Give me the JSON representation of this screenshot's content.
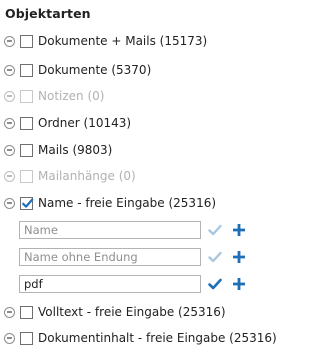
{
  "panel": {
    "title": "Objektarten",
    "items": [
      {
        "label": "Dokumente + Mails (15173)",
        "enabled": true,
        "checked": false
      },
      {
        "label": "Dokumente (5370)",
        "enabled": true,
        "checked": false
      },
      {
        "label": "Notizen (0)",
        "enabled": false,
        "checked": false
      },
      {
        "label": "Ordner (10143)",
        "enabled": true,
        "checked": false
      },
      {
        "label": "Mails (9803)",
        "enabled": true,
        "checked": false
      },
      {
        "label": "Mailanhänge (0)",
        "enabled": false,
        "checked": false
      },
      {
        "label": "Name - freie Eingabe (25316)",
        "enabled": true,
        "checked": true
      },
      {
        "label": "Volltext - freie Eingabe (25316)",
        "enabled": true,
        "checked": false
      },
      {
        "label": "Dokumentinhalt - freie Eingabe (25316)",
        "enabled": true,
        "checked": false
      }
    ],
    "name_inputs": [
      {
        "placeholder": "Name",
        "value": "",
        "confirm_active": false
      },
      {
        "placeholder": "Name ohne Endung",
        "value": "",
        "confirm_active": false
      },
      {
        "placeholder": "",
        "value": "pdf",
        "confirm_active": true
      }
    ]
  },
  "colors": {
    "accent_blue": "#1f6fb8",
    "check_inactive": "#a9c7e0",
    "disabled_text": "#b2b2b2"
  }
}
